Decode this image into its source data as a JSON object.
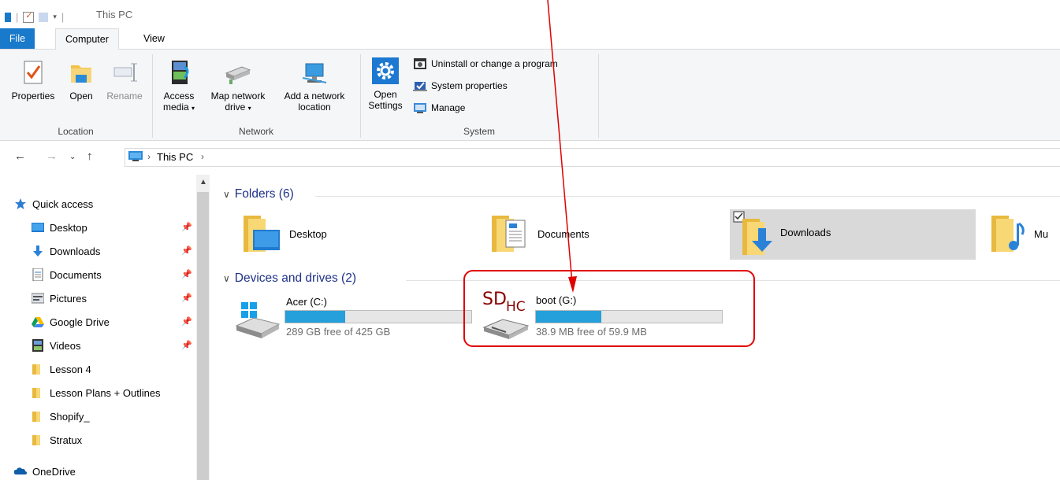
{
  "window": {
    "title": "This PC"
  },
  "tabs": {
    "file": "File",
    "computer": "Computer",
    "view": "View"
  },
  "ribbon": {
    "location": {
      "label": "Location",
      "properties": "Properties",
      "open": "Open",
      "rename": "Rename"
    },
    "network": {
      "label": "Network",
      "access_media_1": "Access",
      "access_media_2": "media",
      "map_drive_1": "Map network",
      "map_drive_2": "drive",
      "add_location_1": "Add a network",
      "add_location_2": "location"
    },
    "system": {
      "label": "System",
      "open_settings_1": "Open",
      "open_settings_2": "Settings",
      "uninstall": "Uninstall or change a program",
      "system_properties": "System properties",
      "manage": "Manage"
    }
  },
  "address": {
    "crumb": "This PC",
    "sep": "›"
  },
  "sidebar": {
    "quick_access": "Quick access",
    "items": [
      {
        "label": "Desktop",
        "icon": "desktop-icon",
        "pinned": true
      },
      {
        "label": "Downloads",
        "icon": "downloads-icon",
        "pinned": true
      },
      {
        "label": "Documents",
        "icon": "documents-icon",
        "pinned": true
      },
      {
        "label": "Pictures",
        "icon": "pictures-icon",
        "pinned": true
      },
      {
        "label": "Google Drive",
        "icon": "google-drive-icon",
        "pinned": true
      },
      {
        "label": "Videos",
        "icon": "videos-icon",
        "pinned": true
      },
      {
        "label": "Lesson 4",
        "icon": "folder-icon",
        "pinned": false
      },
      {
        "label": "Lesson Plans + Outlines",
        "icon": "folder-icon",
        "pinned": false
      },
      {
        "label": "Shopify_",
        "icon": "folder-icon",
        "pinned": false
      },
      {
        "label": "Stratux",
        "icon": "folder-icon",
        "pinned": false
      }
    ],
    "onedrive": "OneDrive"
  },
  "content": {
    "folders_header": "Folders (6)",
    "folders": [
      {
        "label": "Desktop"
      },
      {
        "label": "Documents"
      },
      {
        "label": "Downloads"
      },
      {
        "label": "Mu"
      }
    ],
    "drives_header": "Devices and drives (2)",
    "drives": [
      {
        "name": "Acer (C:)",
        "free": "289 GB free of 425 GB",
        "used_fraction": 0.32
      },
      {
        "name": "boot (G:)",
        "free": "38.9 MB free of 59.9 MB",
        "used_fraction": 0.35
      }
    ],
    "sd_logo": {
      "sd": "SD",
      "hc": "HC"
    }
  },
  "colors": {
    "accent": "#1979ca",
    "bar": "#26a0da",
    "annotation": "#e00000",
    "header_text": "#1e3287"
  }
}
